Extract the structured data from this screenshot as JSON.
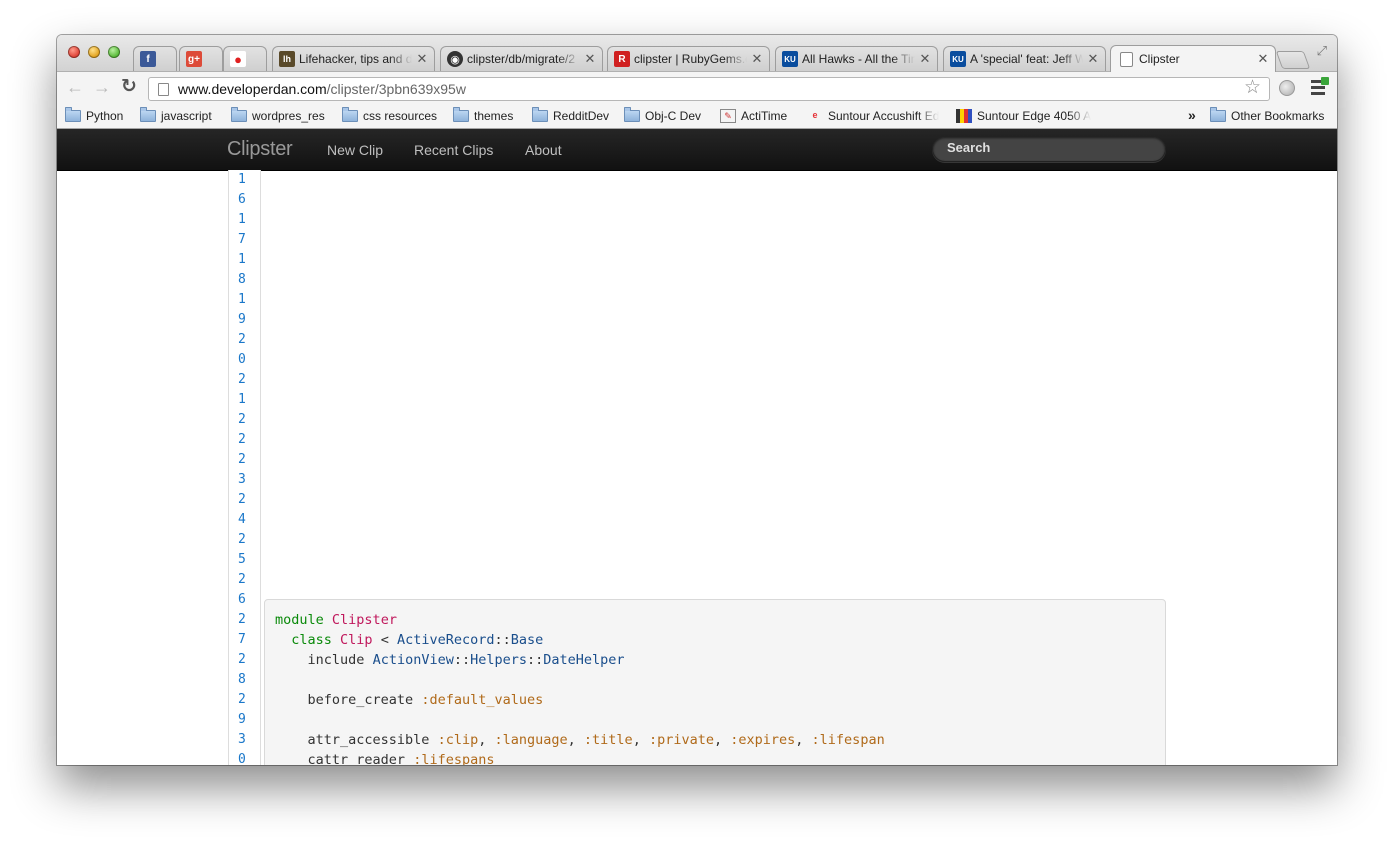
{
  "browser": {
    "tabs": [
      {
        "title": "",
        "favicon": "facebook-icon",
        "color": "#3b5998",
        "glyph": "f"
      },
      {
        "title": "",
        "favicon": "google-plus-icon",
        "color": "#dd4b39",
        "glyph": "g+"
      },
      {
        "title": "",
        "favicon": "record-icon",
        "color": "#e02020",
        "glyph": "●"
      },
      {
        "title": "Lifehacker, tips and do",
        "favicon": "lifehacker-icon",
        "color": "#5a4a2a",
        "glyph": "lh"
      },
      {
        "title": "clipster/db/migrate/2",
        "favicon": "github-icon",
        "color": "#333333",
        "glyph": "◉"
      },
      {
        "title": "clipster | RubyGems.o",
        "favicon": "rubygems-icon",
        "color": "#d02020",
        "glyph": "R"
      },
      {
        "title": "All Hawks - All the Tim",
        "favicon": "ku-icon",
        "color": "#0a4d9e",
        "glyph": "KU"
      },
      {
        "title": "A 'special' feat: Jeff Wi",
        "favicon": "ku-icon",
        "color": "#0a4d9e",
        "glyph": "KU"
      },
      {
        "title": "Clipster",
        "favicon": "page-icon",
        "color": "#ffffff",
        "glyph": ""
      }
    ],
    "address": {
      "host": "www.developerdan.com",
      "path": "/clipster/3pbn639x95w"
    },
    "bookmarks": [
      {
        "label": "Python",
        "type": "folder"
      },
      {
        "label": "javascript",
        "type": "folder"
      },
      {
        "label": "wordpres_res",
        "type": "folder"
      },
      {
        "label": "css resources",
        "type": "folder"
      },
      {
        "label": "themes",
        "type": "folder"
      },
      {
        "label": "RedditDev",
        "type": "folder"
      },
      {
        "label": "Obj-C Dev",
        "type": "folder"
      },
      {
        "label": "ActiTime",
        "type": "site"
      },
      {
        "label": "Suntour Accushift Ed",
        "type": "site"
      },
      {
        "label": "Suntour Edge 4050 A",
        "type": "site"
      }
    ],
    "overflow_label": "»",
    "other_bookmarks": "Other Bookmarks"
  },
  "site": {
    "brand": "Clipster",
    "nav": [
      "New Clip",
      "Recent Clips",
      "About"
    ],
    "search_placeholder": "Search"
  },
  "line_numbers": [
    "1",
    "6",
    "1",
    "7",
    "1",
    "8",
    "1",
    "9",
    "2",
    "0",
    "2",
    "1",
    "2",
    "2",
    "2",
    "3",
    "2",
    "4",
    "2",
    "5",
    "2",
    "6",
    "2",
    "7",
    "2",
    "8",
    "2",
    "9",
    "3",
    "0"
  ],
  "code": {
    "line1": {
      "kw": "module",
      "name": "Clipster"
    },
    "line2": {
      "kw": "class",
      "name": "Clip",
      "op": "<",
      "parent1": "ActiveRecord",
      "sep": "::",
      "parent2": "Base"
    },
    "line3": {
      "kw": "include",
      "c1": "ActionView",
      "c2": "Helpers",
      "c3": "DateHelper"
    },
    "line5": {
      "kw": "before_create",
      "sym": ":default_values"
    },
    "line7": {
      "kw": "attr_accessible",
      "syms": [
        ":clip",
        ":language",
        ":title",
        ":private",
        ":expires",
        ":lifespan"
      ]
    },
    "line8": {
      "kw": "cattr_reader",
      "sym": ":lifespans"
    }
  }
}
